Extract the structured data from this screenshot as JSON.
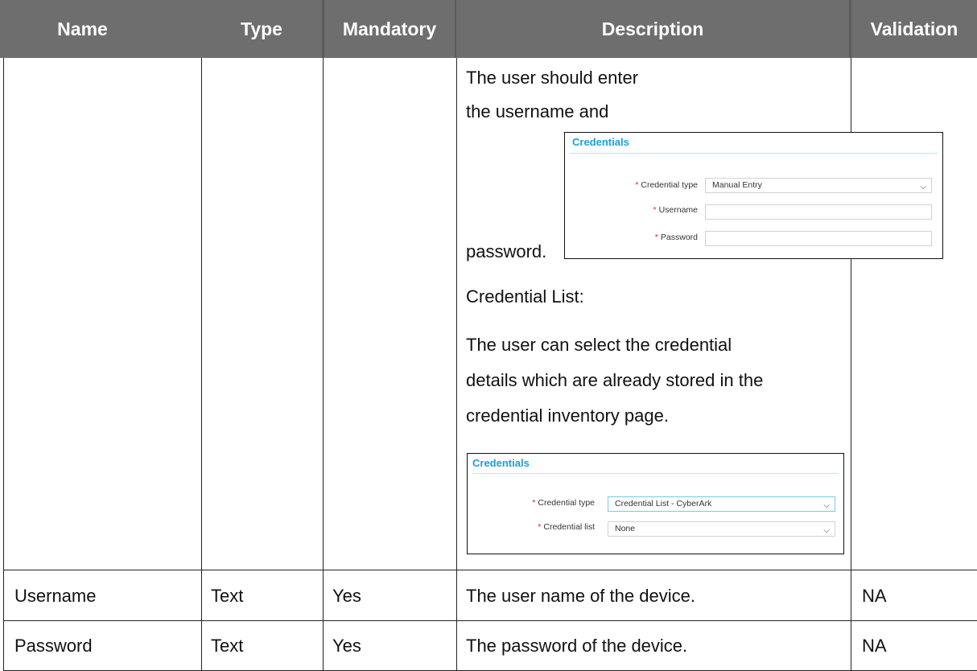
{
  "table": {
    "headers": [
      "Name",
      "Type",
      "Mandatory",
      "Description",
      "Validation"
    ],
    "description_paragraphs": {
      "p1_line1": "The user should enter",
      "p1_line2": "the username and",
      "p1_line3": "password.",
      "p2": "Credential List:",
      "p3_line1": "The user can select the credential",
      "p3_line2": "details which are already stored in the",
      "p3_line3": "credential inventory page."
    },
    "rows": [
      {
        "name": "Username",
        "type": "Text",
        "mandatory": "Yes",
        "description": "The user name of the device.",
        "validation": "NA"
      },
      {
        "name": "Password",
        "type": "Text",
        "mandatory": "Yes",
        "description": "The password of the device.",
        "validation": "NA"
      }
    ]
  },
  "manual_entry_form": {
    "title": "Credentials",
    "required_marker": "*",
    "credential_type_label": "Credential type",
    "credential_type_value": "Manual Entry",
    "username_label": "Username",
    "password_label": "Password"
  },
  "credential_list_form": {
    "title": "Credentials",
    "required_marker": "*",
    "credential_type_label": "Credential type",
    "credential_type_value": "Credential List - CyberArk",
    "credential_list_label": "Credential list",
    "credential_list_value": "None"
  },
  "icons": {
    "dropdown": "chevron-down-icon"
  },
  "colors": {
    "header_bg": "#6e6e6e",
    "form_title": "#1aa0d8",
    "required": "#e02424"
  }
}
